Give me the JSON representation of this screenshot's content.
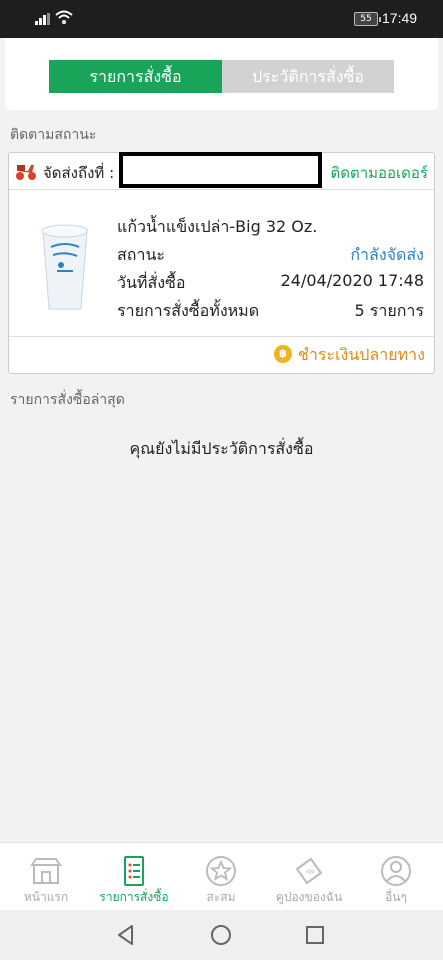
{
  "status_bar": {
    "battery": "55",
    "time": "17:49"
  },
  "tabs": [
    {
      "label": "รายการสั่งซื้อ",
      "active": true
    },
    {
      "label": "ประวัติการสั่งซื้อ",
      "active": false
    }
  ],
  "tracking": {
    "section_label": "ติดตามสถานะ",
    "ship_to_label": "จัดส่งถึงที่ :",
    "track_link": "ติดตามออเดอร์",
    "product_name": "แก้วน้ำแข็งเปล่า-Big 32 Oz.",
    "status_label": "สถานะ",
    "status_value": "กำลังจัดส่ง",
    "order_date_label": "วันที่สั่งซื้อ",
    "order_date_value": "24/04/2020 17:48",
    "total_items_label": "รายการสั่งซื้อทั้งหมด",
    "total_items_value": "5 รายการ",
    "payment_method": "ชำระเงินปลายทาง",
    "coin_symbol": "฿"
  },
  "recent": {
    "section_label": "รายการสั่งซื้อล่าสุด",
    "empty_message": "คุณยังไม่มีประวัติการสั่งซื้อ"
  },
  "bottom_nav": [
    {
      "label": "หน้าแรก",
      "icon": "store-icon",
      "active": false
    },
    {
      "label": "รายการสั่งซื้อ",
      "icon": "order-list-icon",
      "active": true
    },
    {
      "label": "สะสม",
      "icon": "star-icon",
      "active": false
    },
    {
      "label": "คูปองของฉัน",
      "icon": "coupon-icon",
      "active": false
    },
    {
      "label": "อื่นๆ",
      "icon": "profile-icon",
      "active": false
    }
  ],
  "colors": {
    "brand_green": "#19a45a",
    "status_blue": "#2e7fc4",
    "payment_orange": "#e08a16"
  }
}
